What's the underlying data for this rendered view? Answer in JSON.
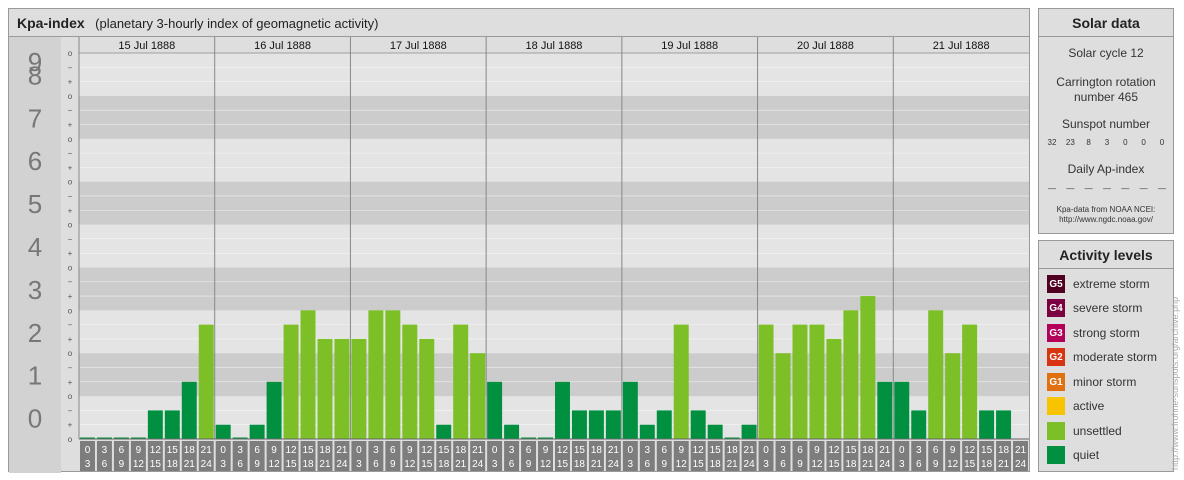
{
  "header": {
    "title": "Kpa-index",
    "subtitle": "(planetary 3-hourly index of geomagnetic activity)"
  },
  "chart_data": {
    "type": "bar",
    "ylim": [
      0,
      9
    ],
    "y_ticks": [
      "0",
      "1",
      "2",
      "3",
      "4",
      "5",
      "6",
      "7",
      "8",
      "9"
    ],
    "minor_tick_labels": [
      "o",
      "+",
      "−"
    ],
    "days": [
      "15 Jul 1888",
      "16 Jul 1888",
      "17 Jul 1888",
      "18 Jul 1888",
      "19 Jul 1888",
      "20 Jul 1888",
      "21 Jul 1888"
    ],
    "intervals": [
      [
        "0",
        "3"
      ],
      [
        "3",
        "6"
      ],
      [
        "6",
        "9"
      ],
      [
        "9",
        "12"
      ],
      [
        "12",
        "15"
      ],
      [
        "15",
        "18"
      ],
      [
        "18",
        "21"
      ],
      [
        "21",
        "24"
      ]
    ],
    "values": [
      0,
      0,
      0,
      0,
      0.667,
      0.667,
      1.333,
      2.667,
      0.333,
      0,
      0.333,
      1.333,
      2.667,
      3,
      2.333,
      2.333,
      2.333,
      3,
      3,
      2.667,
      2.333,
      0.333,
      2.667,
      2,
      1.333,
      0.333,
      0,
      0,
      1.333,
      0.667,
      0.667,
      0.667,
      1.333,
      0.333,
      0.667,
      2.667,
      0.667,
      0.333,
      0,
      0.333,
      2.667,
      2,
      2.667,
      2.667,
      2.333,
      3,
      3.333,
      1.333,
      1.333,
      0.667,
      3,
      2,
      2.667,
      0.667,
      0.667
    ],
    "colors": {
      "quiet": "#009040",
      "unsettled": "#7cbf26",
      "row_dark": "#cccccc",
      "row_light": "#e4e4e4",
      "axis_label": "#777777"
    }
  },
  "solar": {
    "title": "Solar data",
    "cycle": "Solar cycle 12",
    "carrington_1": "Carrington rotation",
    "carrington_2": "number 465",
    "sunspot_title": "Sunspot number",
    "sunspots": [
      "32",
      "23",
      "8",
      "3",
      "0",
      "0",
      "0"
    ],
    "ap_title": "Daily Ap-index",
    "ap_values": [
      "—",
      "—",
      "—",
      "—",
      "—",
      "—",
      "—"
    ],
    "source_1": "Kpa-data from NOAA NCEI:",
    "source_2": "http://www.ngdc.noaa.gov/"
  },
  "activity": {
    "title": "Activity levels",
    "levels": [
      {
        "badge": "G5",
        "label": "extreme storm",
        "color": "#500020"
      },
      {
        "badge": "G4",
        "label": "severe storm",
        "color": "#7a0040"
      },
      {
        "badge": "G3",
        "label": "strong storm",
        "color": "#b4005a"
      },
      {
        "badge": "G2",
        "label": "moderate storm",
        "color": "#d83410"
      },
      {
        "badge": "G1",
        "label": "minor storm",
        "color": "#e07010"
      },
      {
        "badge": "",
        "label": "active",
        "color": "#f8c400"
      },
      {
        "badge": "",
        "label": "unsettled",
        "color": "#7cbf26"
      },
      {
        "badge": "",
        "label": "quiet",
        "color": "#009040"
      }
    ]
  },
  "watermark": "http://www.frohne-sunspots.org/archive.php"
}
